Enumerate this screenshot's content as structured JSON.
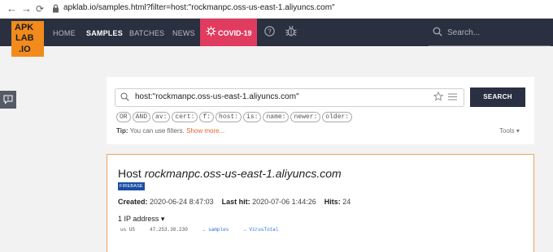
{
  "browser": {
    "url": "apklab.io/samples.html?filter=host:\"rockmanpc.oss-us-east-1.aliyuncs.com\""
  },
  "logo": {
    "line1": "APK",
    "line2": "LAB",
    "line3": ".IO"
  },
  "nav": {
    "home": "HOME",
    "samples": "SAMPLES",
    "batches": "BATCHES",
    "news": "NEWS",
    "covid": "COVID-19",
    "search_placeholder": "Search..."
  },
  "search": {
    "query": "host:\"rockmanpc.oss-us-east-1.aliyuncs.com\"",
    "button": "SEARCH",
    "chips": [
      "OR",
      "AND",
      "av:",
      "cert:",
      "f:",
      "host:",
      "is:",
      "name:",
      "newer:",
      "older:"
    ],
    "tip_label": "Tip:",
    "tip_text": "You can use filters.",
    "show_more": "Show more...",
    "tools": "Tools"
  },
  "host": {
    "prefix": "Host",
    "name": "rockmanpc.oss-us-east-1.aliyuncs.com",
    "badge": "FIREBASE",
    "created_label": "Created:",
    "created": "2020-06-24 8:47:03",
    "last_hit_label": "Last hit:",
    "last_hit": "2020-07-06 1:44:26",
    "hits_label": "Hits:",
    "hits": "24",
    "ip_header": "1 IP address",
    "ip_country_code": "us",
    "ip_country": "US",
    "ip": "47.253.30.230",
    "ip_link_samples": "samples",
    "ip_link_vt": "VirusTotal"
  },
  "colors": {
    "navbar": "#2b3040",
    "accent": "#f28b1c",
    "covid": "#e03c5f",
    "badge": "#1b4ea3"
  }
}
